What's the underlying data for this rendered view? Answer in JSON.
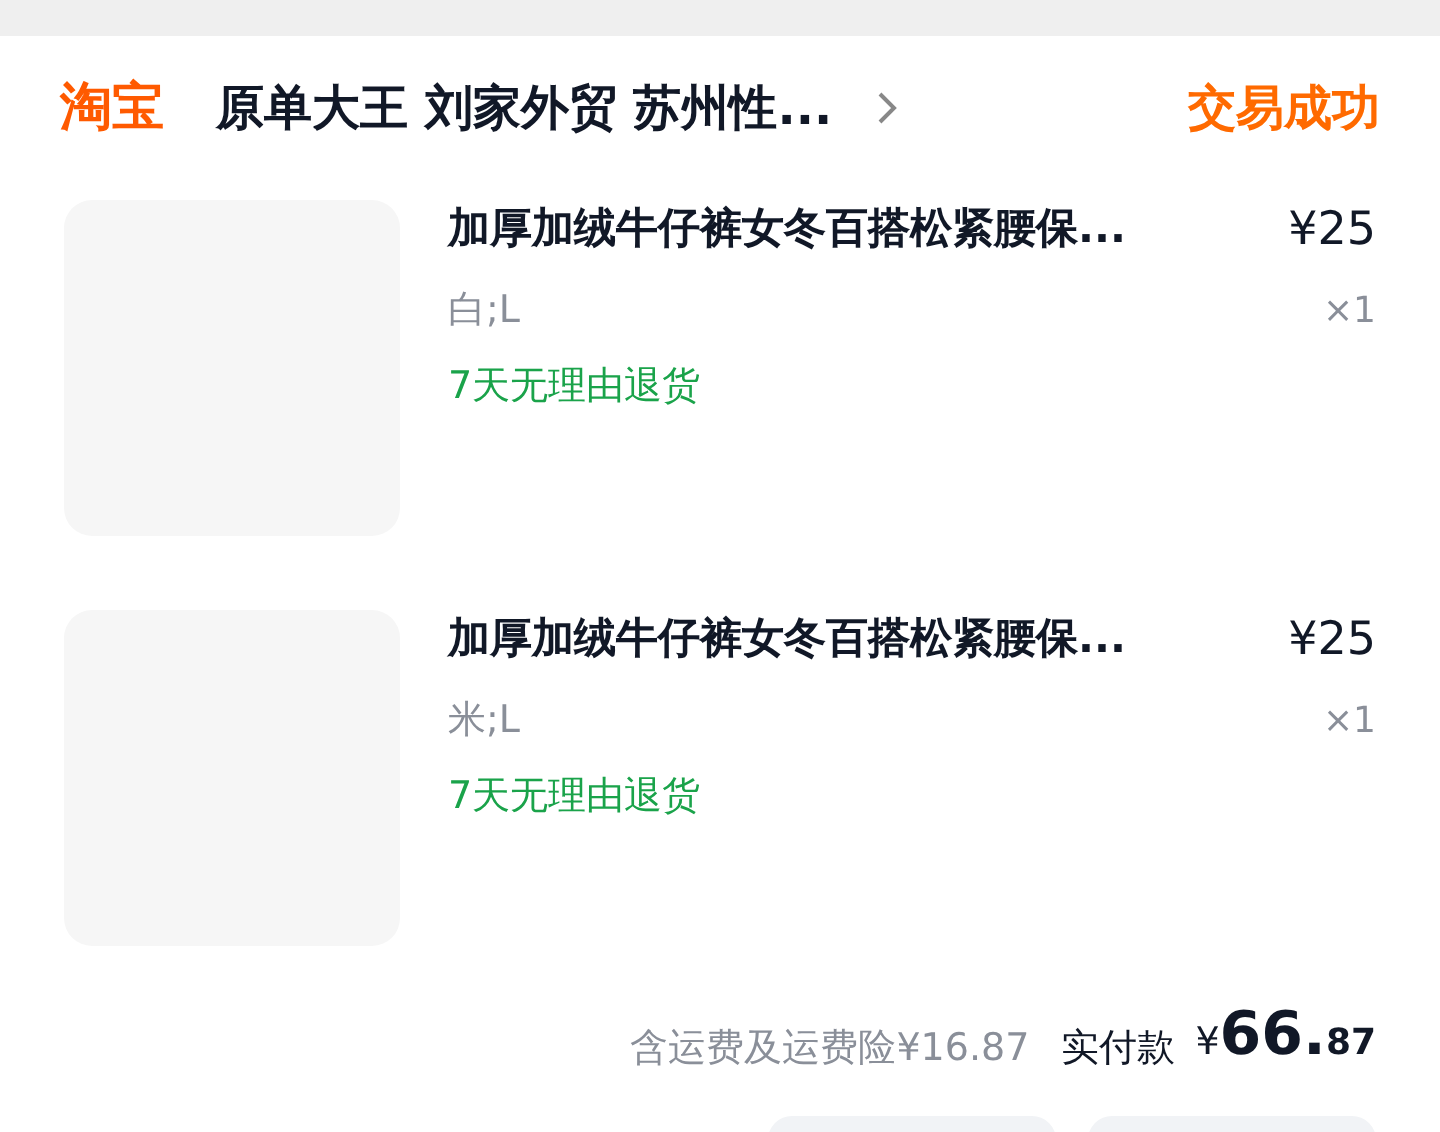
{
  "header": {
    "brand": "淘宝",
    "shop_name": "原单大王 刘家外贸 苏州性...",
    "status": "交易成功"
  },
  "items": [
    {
      "title": "加厚加绒牛仔裤女冬百搭松紧腰保...",
      "price": "¥25",
      "variant": "白;L",
      "quantity": "×1",
      "tag": "7天无理由退货"
    },
    {
      "title": "加厚加绒牛仔裤女冬百搭松紧腰保...",
      "price": "¥25",
      "variant": "米;L",
      "quantity": "×1",
      "tag": "7天无理由退货"
    }
  ],
  "summary": {
    "shipping": "含运费及运费险¥16.87",
    "paid_label": "实付款",
    "paid_symbol": "¥",
    "paid_integer": "66.",
    "paid_fraction": "87"
  }
}
